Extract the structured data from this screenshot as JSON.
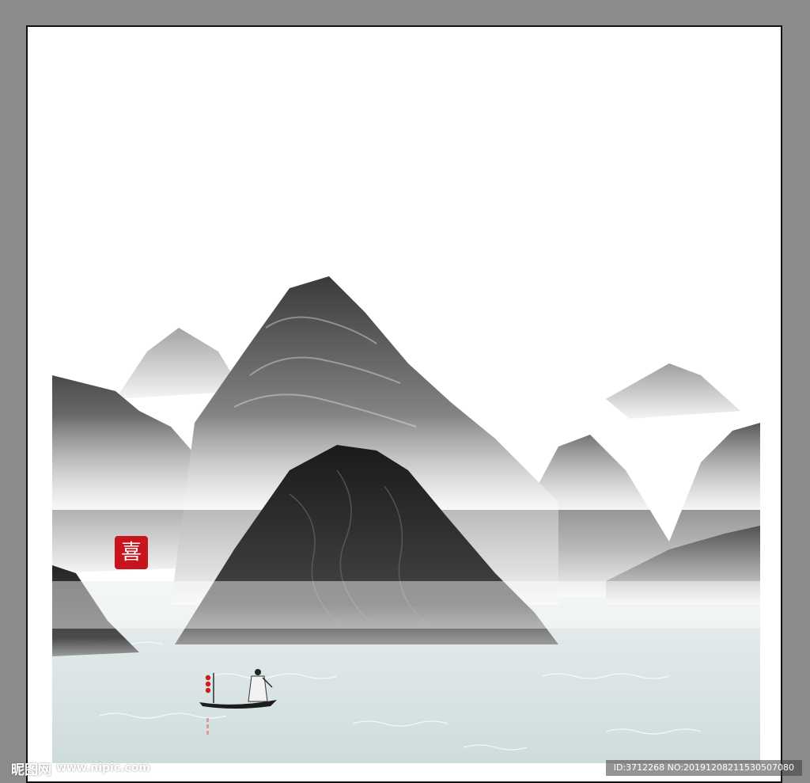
{
  "seal": {
    "glyph": "喜"
  },
  "watermark": {
    "logo": "昵图网",
    "url": "www.nipic.com",
    "id_text": "ID:3712268 NO:20191208211530507080"
  },
  "colors": {
    "frame": "#8c8c8c",
    "paper": "#ffffff",
    "water": "#d6e2e2",
    "seal": "#c8141c",
    "ink_dark": "#222222"
  },
  "icons": {
    "seal": "red-seal-icon",
    "boat": "boat-icon",
    "lanterns": "lantern-icon"
  }
}
